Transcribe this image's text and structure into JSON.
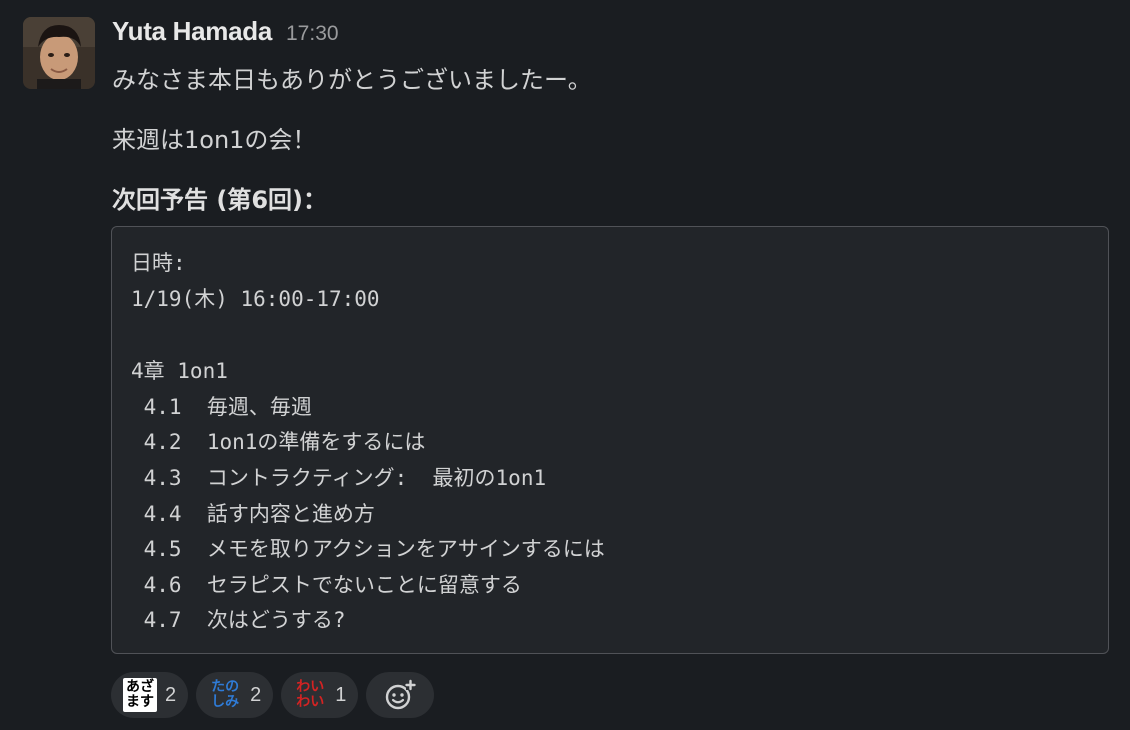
{
  "message": {
    "author": "Yuta Hamada",
    "time": "17:30",
    "lines": [
      "みなさま本日もありがとうございましたー。",
      "来週は1on1の会！",
      "次回予告 (第6回)："
    ]
  },
  "codeblock": {
    "lines": [
      "日時:",
      "1/19(木) 16:00-17:00",
      "",
      "4章 1on1",
      " 4.1  毎週、毎週",
      " 4.2  1on1の準備をするには",
      " 4.3  コントラクティング:  最初の1on1",
      " 4.4  話す内容と進め方",
      " 4.5  メモを取りアクションをアサインするには",
      " 4.6  セラピストでないことに留意する",
      " 4.7  次はどうする?"
    ]
  },
  "reactions": [
    {
      "emoji_text": [
        "あざ",
        "ます"
      ],
      "count": "2",
      "icon": "azamasu-emoji"
    },
    {
      "emoji_text": [
        "たの",
        "しみ"
      ],
      "count": "2",
      "icon": "tanoshimi-emoji"
    },
    {
      "emoji_text": [
        "わい",
        "わい"
      ],
      "count": "1",
      "icon": "waiwai-emoji"
    }
  ],
  "add_reaction": {
    "icon": "add-reaction-icon"
  },
  "colors": {
    "background": "#1a1d21",
    "codeblock_bg": "#222529",
    "reaction_bg": "#2c2f33",
    "tanoshimi": "#2f7bd6",
    "waiwai": "#d32323"
  }
}
